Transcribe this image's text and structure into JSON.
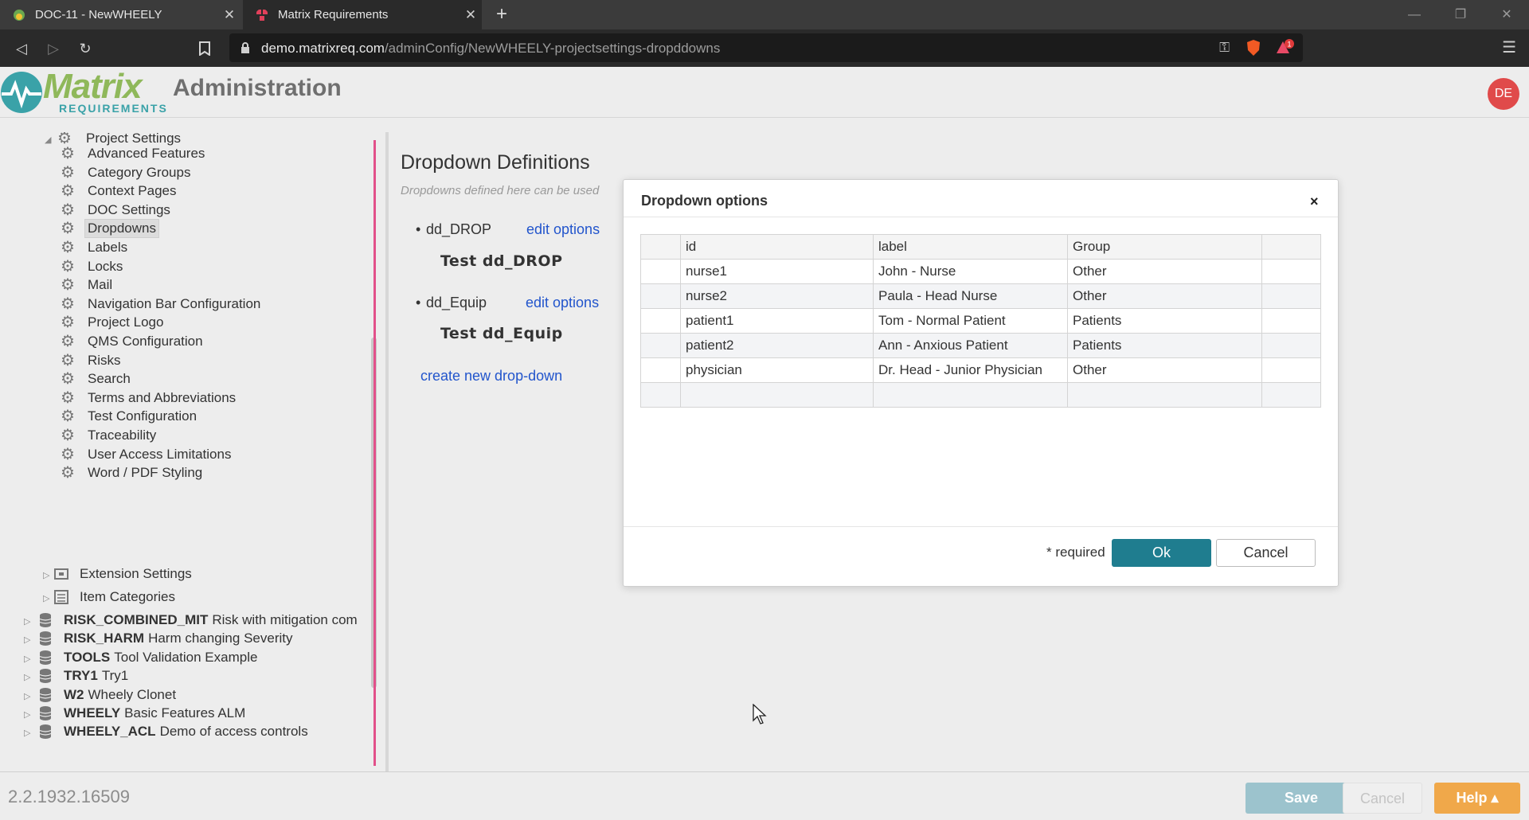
{
  "browser": {
    "tabs": [
      {
        "title": "DOC-11 - NewWHEELY",
        "active": false
      },
      {
        "title": "Matrix Requirements",
        "active": true
      }
    ],
    "url_host": "demo.matrixreq.com",
    "url_path": "/adminConfig/NewWHEELY-projectsettings-dropddowns",
    "rewards_badge": "1"
  },
  "header": {
    "logo_word": "Matrix",
    "logo_sub": "REQUIREMENTS",
    "title": "Administration",
    "avatar_initials": "DE"
  },
  "sidebar": {
    "section_label": "Project Settings",
    "settings_items": [
      "Advanced Features",
      "Category Groups",
      "Context Pages",
      "DOC Settings",
      "Dropdowns",
      "Labels",
      "Locks",
      "Mail",
      "Navigation Bar Configuration",
      "Project Logo",
      "QMS Configuration",
      "Risks",
      "Search",
      "Terms and Abbreviations",
      "Test Configuration",
      "Traceability",
      "User Access Limitations",
      "Word / PDF Styling"
    ],
    "selected_item": "Dropdowns",
    "extension_settings": "Extension Settings",
    "item_categories": "Item Categories",
    "projects": [
      {
        "code": "RISK_COMBINED_MIT",
        "name": "Risk with mitigation com"
      },
      {
        "code": "RISK_HARM",
        "name": "Harm changing Severity"
      },
      {
        "code": "TOOLS",
        "name": "Tool Validation Example"
      },
      {
        "code": "TRY1",
        "name": "Try1"
      },
      {
        "code": "W2",
        "name": "Wheely Clonet"
      },
      {
        "code": "WHEELY",
        "name": "Basic Features ALM"
      },
      {
        "code": "WHEELY_ACL",
        "name": "Demo of access controls"
      }
    ]
  },
  "main": {
    "title": "Dropdown Definitions",
    "description": "Dropdowns defined here can be used",
    "dropdowns": [
      {
        "name": "dd_DROP",
        "link": "edit options",
        "test": "Test dd_DROP"
      },
      {
        "name": "dd_Equip",
        "link": "edit options",
        "test": "Test dd_Equip"
      }
    ],
    "create_link": "create new drop-down"
  },
  "dialog": {
    "title": "Dropdown options",
    "close": "×",
    "columns": [
      "id",
      "label",
      "Group"
    ],
    "rows": [
      {
        "id": "nurse1",
        "label": "John - Nurse",
        "group": "Other"
      },
      {
        "id": "nurse2",
        "label": "Paula - Head Nurse",
        "group": "Other"
      },
      {
        "id": "patient1",
        "label": "Tom - Normal Patient",
        "group": "Patients"
      },
      {
        "id": "patient2",
        "label": "Ann - Anxious Patient",
        "group": "Patients"
      },
      {
        "id": "physician",
        "label": "Dr. Head - Junior Physician",
        "group": "Other"
      }
    ],
    "required_note": "* required",
    "ok_label": "Ok",
    "cancel_label": "Cancel"
  },
  "footer": {
    "version": "2.2.1932.16509",
    "save_label": "Save",
    "cancel_label": "Cancel",
    "help_label": "Help"
  },
  "colors": {
    "accent": "#1f7d8f",
    "brand_green": "#8fb85a",
    "brand_teal": "#3aa2a8",
    "help": "#f0a84a",
    "splitter": "#e2508a",
    "link": "#2255cc"
  }
}
